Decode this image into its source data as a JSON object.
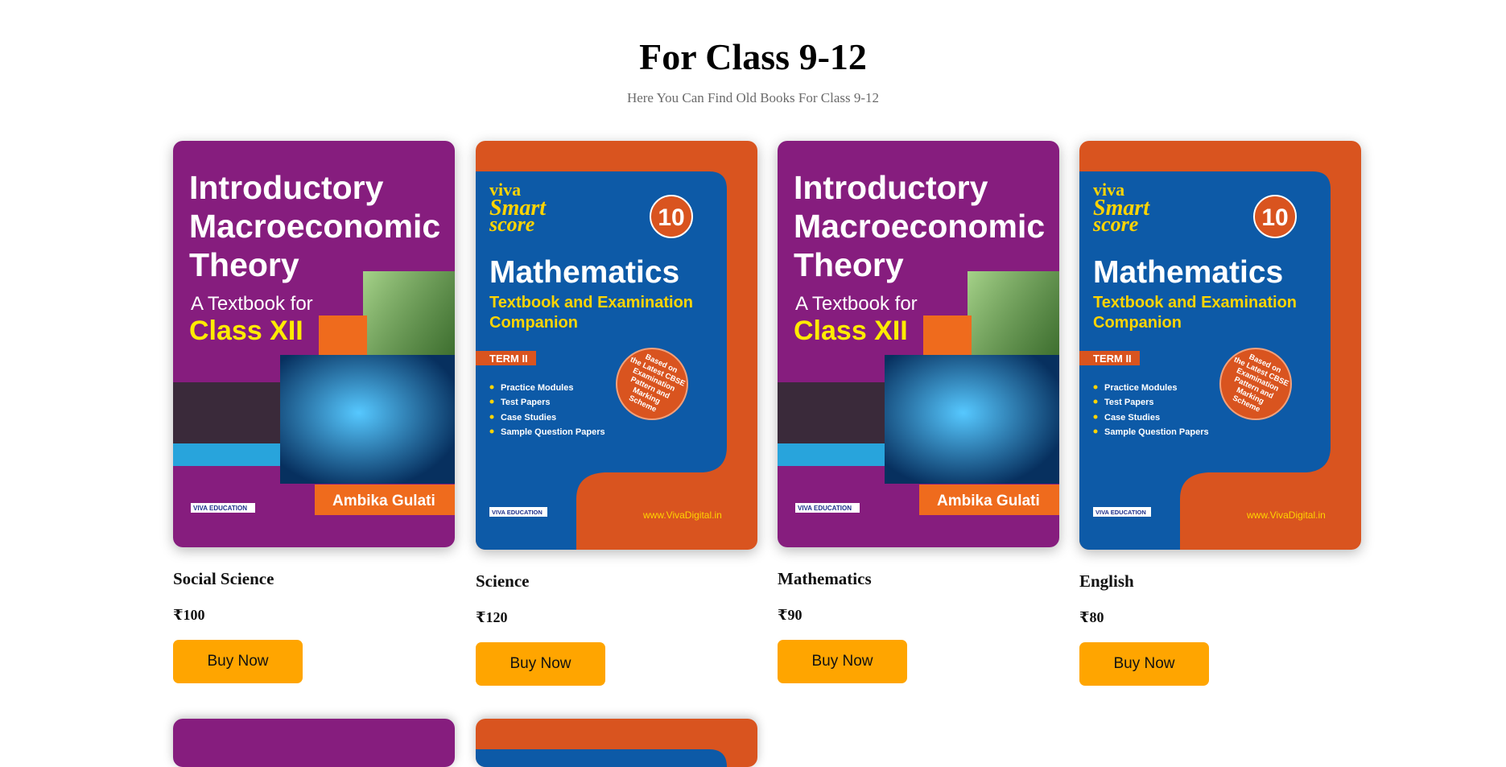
{
  "header": {
    "title": "For Class 9-12",
    "subtitle": "Here You Can Find Old Books For Class 9-12"
  },
  "covers": {
    "macro": {
      "line1": "Introductory",
      "line2": "Macroeconomic",
      "line3": "Theory",
      "subtitle1": "A Textbook for",
      "subtitle2": "Class XII",
      "author": "Ambika Gulati",
      "publisher": "VIVA EDUCATION"
    },
    "maths": {
      "brand": "viva",
      "series1": "Smart",
      "series2": "score",
      "grade": "10",
      "title": "Mathematics",
      "subtitle1": "Textbook and Examination",
      "subtitle2": "Companion",
      "term": "TERM II",
      "bullets": [
        "Practice Modules",
        "Test Papers",
        "Case Studies",
        "Sample Question Papers"
      ],
      "badge": [
        "Based on",
        "the Latest CBSE",
        "Examination",
        "Pattern and",
        "Marking",
        "Scheme"
      ],
      "website": "www.VivaDigital.in",
      "publisher": "VIVA EDUCATION"
    }
  },
  "products": [
    {
      "name": "Social Science",
      "price": "₹100",
      "button": "Buy Now"
    },
    {
      "name": "Science",
      "price": "₹120",
      "button": "Buy Now"
    },
    {
      "name": "Mathematics",
      "price": "₹90",
      "button": "Buy Now"
    },
    {
      "name": "English",
      "price": "₹80",
      "button": "Buy Now"
    }
  ],
  "colors": {
    "button": "#ffa500",
    "macro_cover": "#861d7e",
    "maths_cover_outer": "#d9541f",
    "maths_cover_inner": "#0d5aa7"
  }
}
